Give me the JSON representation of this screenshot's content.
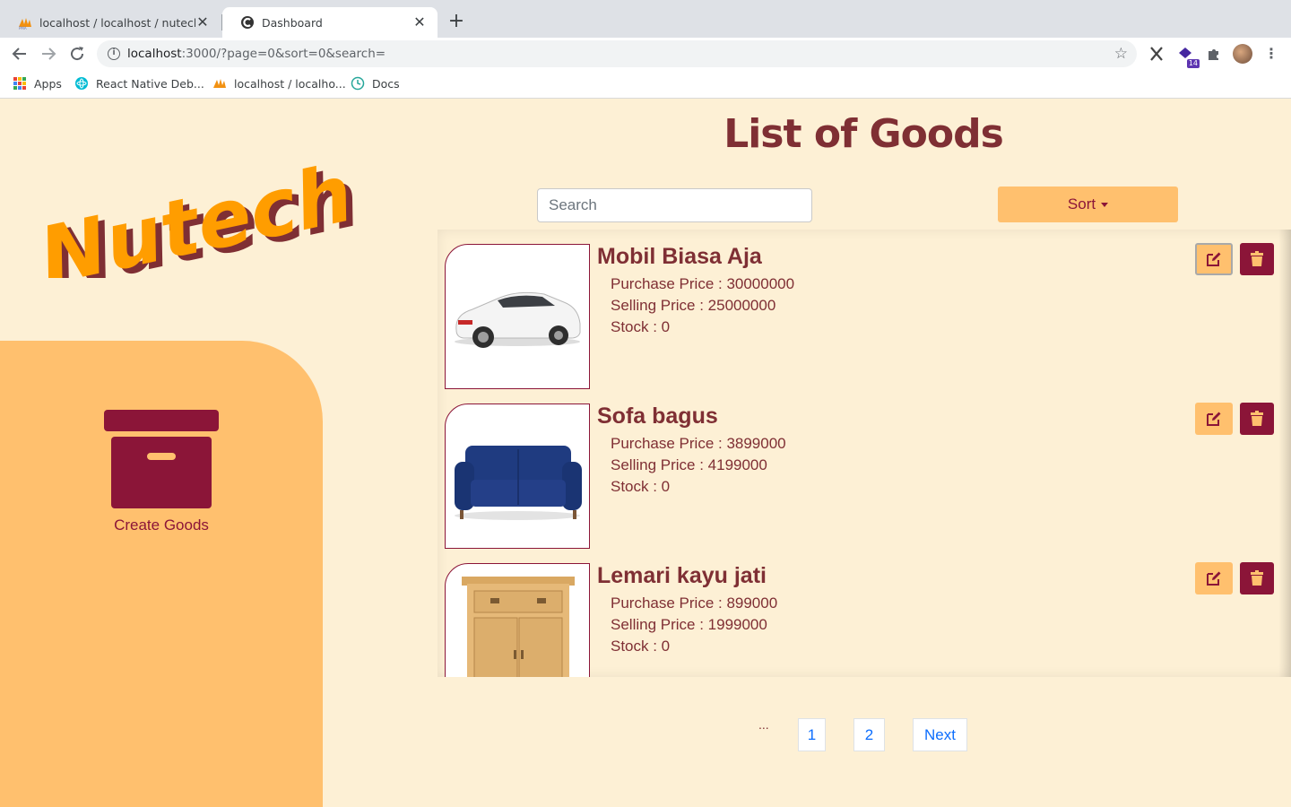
{
  "browser": {
    "tabs": [
      {
        "title": "localhost / localhost / nutech / goods | phpMyAdmin",
        "active": false
      },
      {
        "title": "Dashboard",
        "active": true
      }
    ],
    "url_host": "localhost",
    "url_rest": ":3000/?page=0&sort=0&search=",
    "extension_badge": "14",
    "bookmarks": [
      {
        "label": "Apps",
        "icon": "apps-grid-icon"
      },
      {
        "label": "React Native Deb...",
        "icon": "react-icon"
      },
      {
        "label": "localhost / localho...",
        "icon": "phpmyadmin-icon"
      },
      {
        "label": "Docs",
        "icon": "clock-icon"
      }
    ]
  },
  "sidebar": {
    "logo_text": "Nutech",
    "create_label": "Create Goods"
  },
  "main": {
    "title": "List of Goods",
    "search_placeholder": "Search",
    "sort_label": "Sort",
    "items": [
      {
        "name": "Mobil Biasa Aja",
        "purchase": "Purchase Price : 30000000",
        "selling": "Selling Price : 25000000",
        "stock": "Stock : 0",
        "image": "car"
      },
      {
        "name": "Sofa bagus",
        "purchase": "Purchase Price : 3899000",
        "selling": "Selling Price : 4199000",
        "stock": "Stock : 0",
        "image": "sofa"
      },
      {
        "name": "Lemari kayu jati",
        "purchase": "Purchase Price : 899000",
        "selling": "Selling Price : 1999000",
        "stock": "Stock : 0",
        "image": "cabinet"
      }
    ],
    "pagination": {
      "ellipsis": "...",
      "pages": [
        "1",
        "2"
      ],
      "next": "Next"
    }
  },
  "colors": {
    "background": "#fdf0d5",
    "accent_orange": "#ffc06e",
    "maroon": "#8b1538",
    "title_brown": "#7f2f34",
    "logo_orange": "#ff9d00"
  }
}
